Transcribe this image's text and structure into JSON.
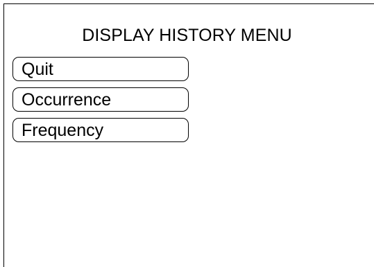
{
  "menu": {
    "title": "DISPLAY HISTORY MENU",
    "items": [
      {
        "label": "Quit"
      },
      {
        "label": "Occurrence"
      },
      {
        "label": "Frequency"
      }
    ]
  }
}
